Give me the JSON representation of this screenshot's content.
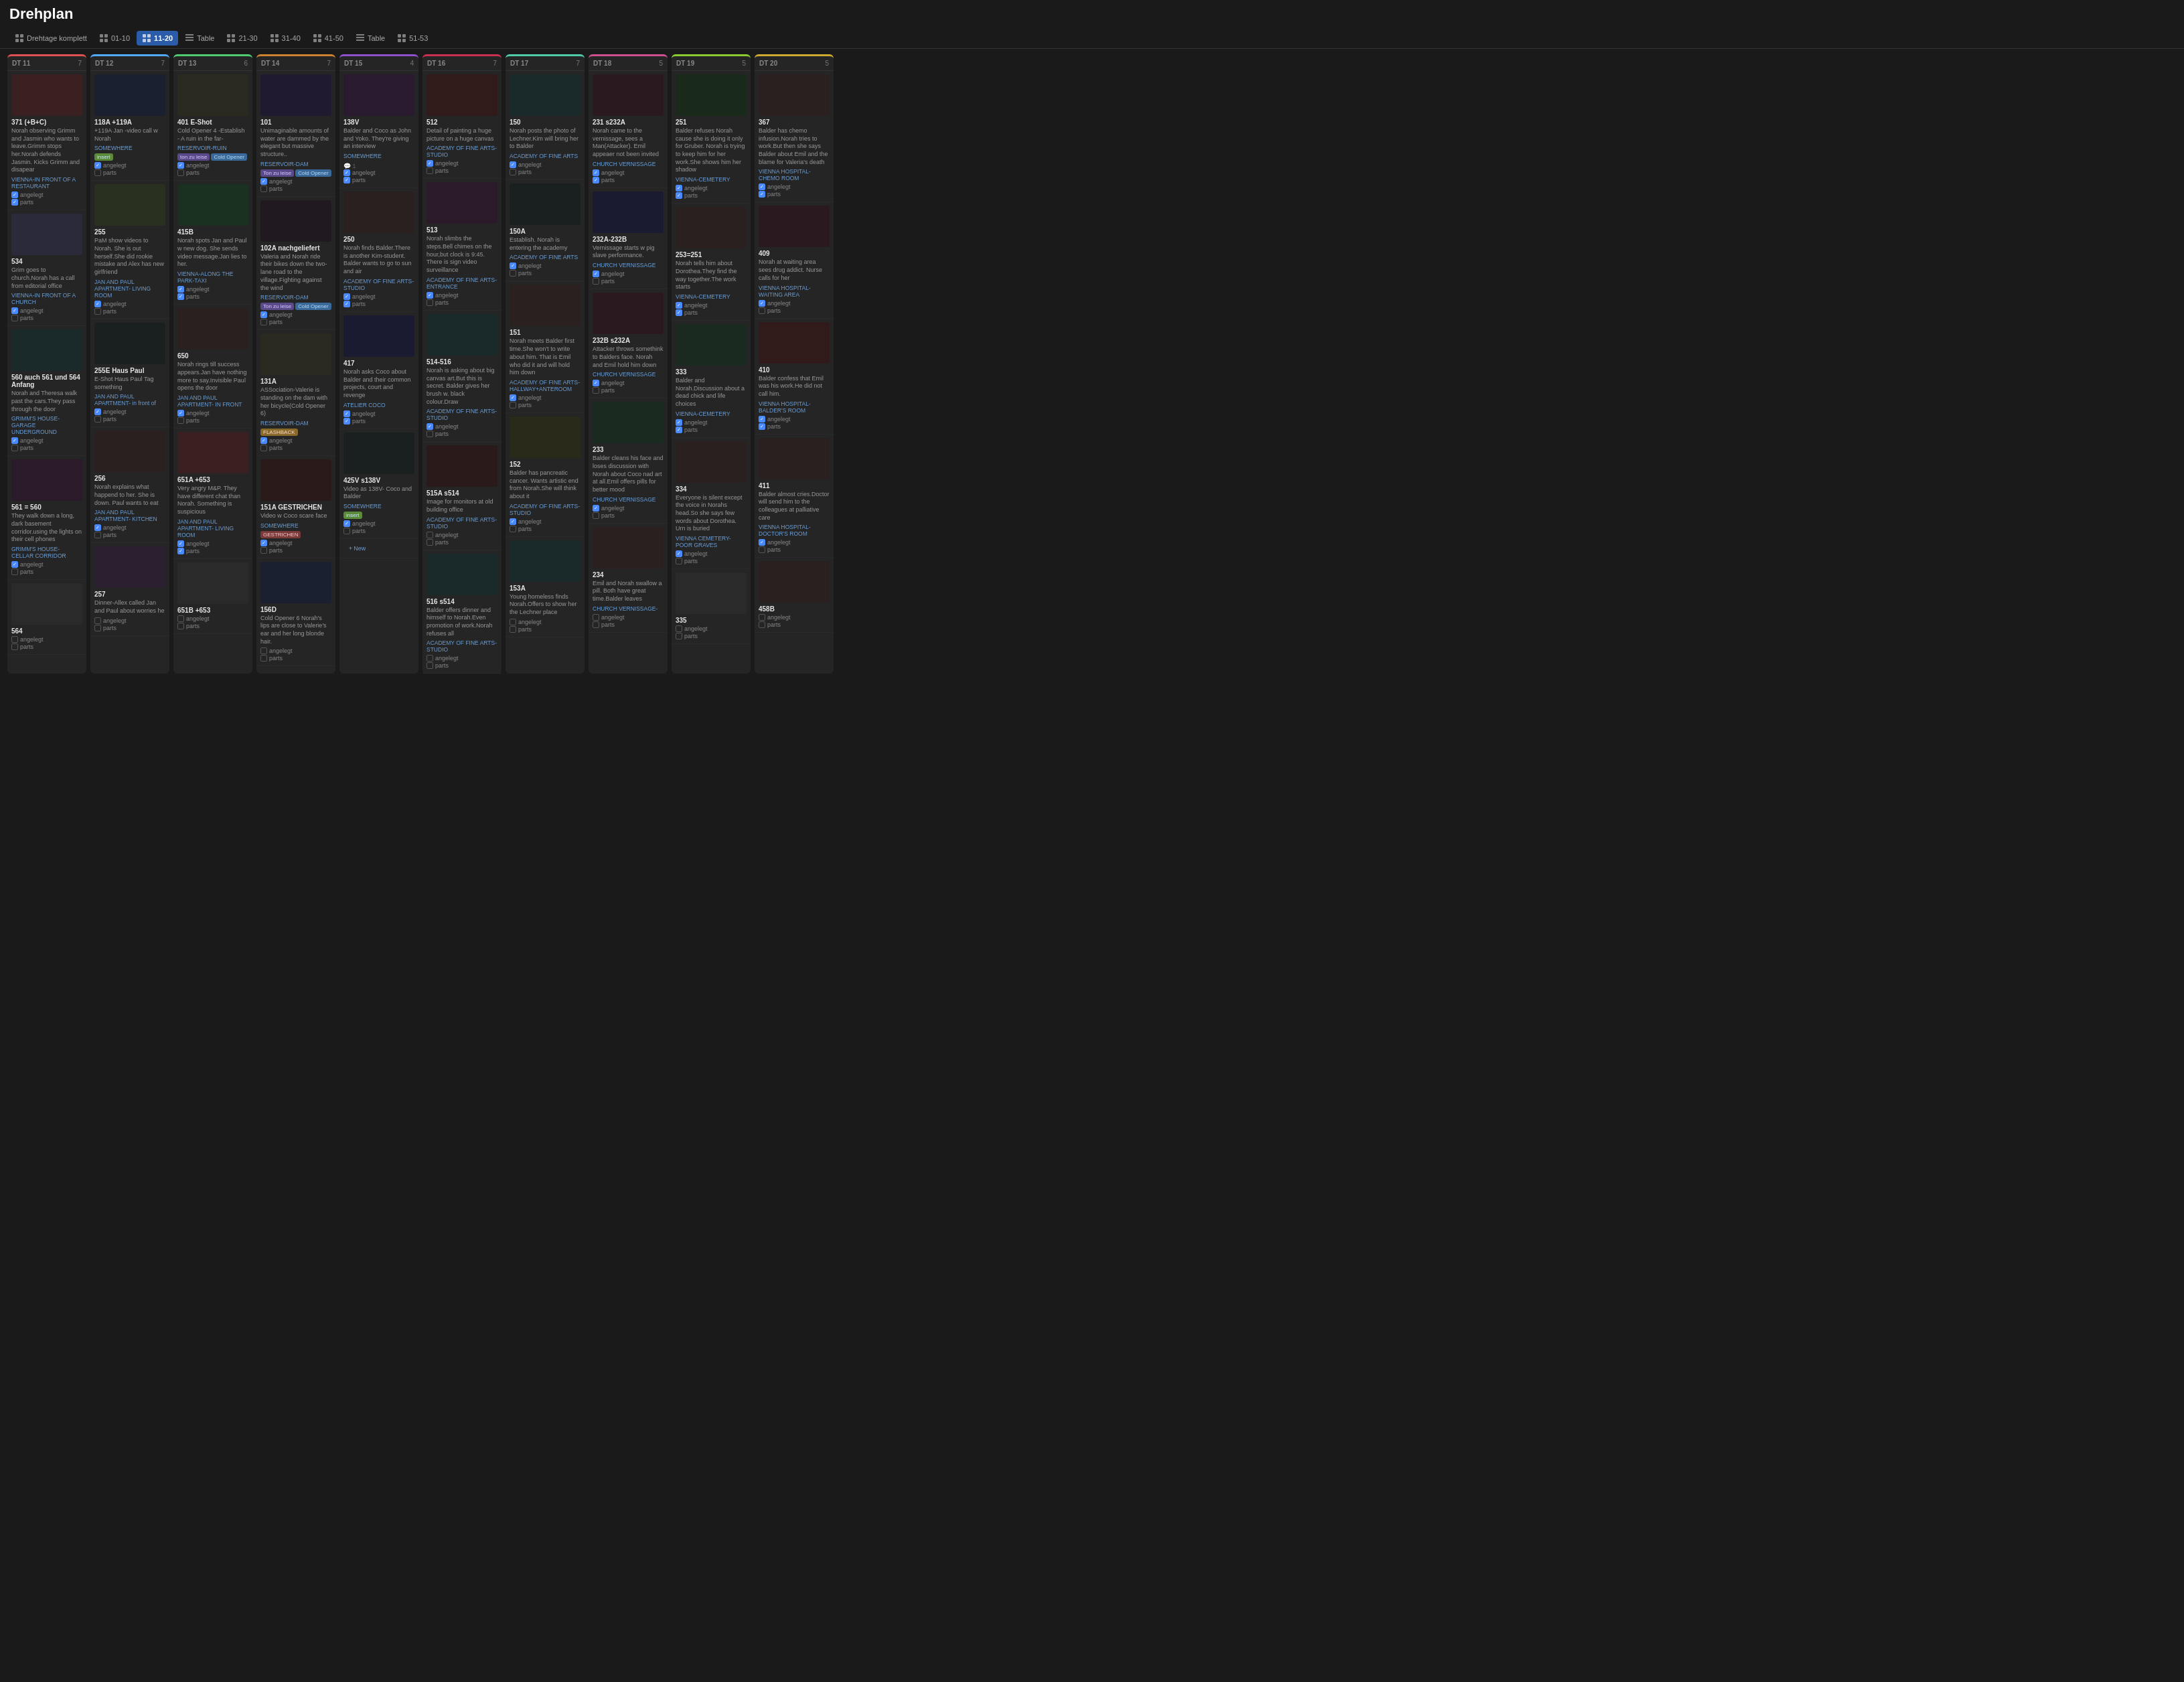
{
  "app": {
    "title": "Drehplan"
  },
  "nav": {
    "items": [
      {
        "id": "drehtage",
        "label": "Drehtage komplett",
        "icon": "grid",
        "active": false
      },
      {
        "id": "01-10",
        "label": "01-10",
        "icon": "grid",
        "active": false
      },
      {
        "id": "11-20",
        "label": "11-20",
        "icon": "grid",
        "active": true
      },
      {
        "id": "table1",
        "label": "Table",
        "icon": "table",
        "active": false
      },
      {
        "id": "21-30",
        "label": "21-30",
        "icon": "grid",
        "active": false
      },
      {
        "id": "31-40",
        "label": "31-40",
        "icon": "grid",
        "active": false
      },
      {
        "id": "41-50",
        "label": "41-50",
        "icon": "grid",
        "active": false
      },
      {
        "id": "table2",
        "label": "Table",
        "icon": "table",
        "active": false
      },
      {
        "id": "51-53",
        "label": "51-53",
        "icon": "grid",
        "active": false
      }
    ]
  },
  "columns": [
    {
      "id": "dt11",
      "dt": "DT 11",
      "count": 7,
      "colorClass": "dt11",
      "scenes": [
        {
          "title": "371 (+B+C)",
          "desc": "Norah observing Grimm and Jasmin who wants to leave.Grimm stops her.Norah defends Jasmin. Kicks Grimm and disapear",
          "location": "VIENNA-IN FRONT OF A RESTAURANT",
          "angelegt": true,
          "parts": true,
          "hasComment": false,
          "tags": []
        },
        {
          "title": "534",
          "desc": "Grim goes to church.Norah has a call from editorial office",
          "location": "VIENNA-IN FRONT OF A CHURCH",
          "angelegt": true,
          "parts": false,
          "hasComment": false,
          "tags": []
        },
        {
          "title": "560 auch 561 und 564 Anfang",
          "desc": "Norah and Theresa walk past the cars.They pass through the door",
          "location": "GRIMM'S HOUSE- GARAGE UNDERGROUND",
          "angelegt": true,
          "parts": false,
          "hasComment": false,
          "tags": []
        },
        {
          "title": "561 = 560",
          "desc": "They walk down a long, dark basement corridor.using the lights on their cell phones",
          "location": "GRIMM'S HOUSE- CELLAR CORRIDOR",
          "angelegt": true,
          "parts": false,
          "hasComment": false,
          "tags": []
        },
        {
          "title": "564",
          "desc": "",
          "location": "",
          "angelegt": false,
          "parts": false,
          "hasComment": false,
          "tags": []
        }
      ]
    },
    {
      "id": "dt12",
      "dt": "DT 12",
      "count": 7,
      "colorClass": "dt12",
      "scenes": [
        {
          "title": "118A +119A",
          "desc": "+119A Jan -video call w Norah",
          "location": "SOMEWHERE",
          "angelegt": true,
          "parts": false,
          "hasComment": false,
          "tags": [
            "insert"
          ]
        },
        {
          "title": "255",
          "desc": "PaM show videos to Norah. She is out herself.She did rookie mistake and Alex has new girlfriend",
          "location": "JAN AND PAUL APARTMENT- LIVING ROOM",
          "angelegt": true,
          "parts": false,
          "hasComment": false,
          "tags": []
        },
        {
          "title": "255E Haus Paul",
          "desc": "E-Shot Haus Paul Tag something",
          "location": "JAN AND PAUL APARTMENT- in front of",
          "angelegt": true,
          "parts": false,
          "hasComment": false,
          "tags": []
        },
        {
          "title": "256",
          "desc": "Norah explains what happend to her. She is down. Paul wants to eat",
          "location": "JAN AND PAUL APARTMENT- KITCHEN",
          "angelegt": true,
          "parts": false,
          "hasComment": false,
          "tags": []
        },
        {
          "title": "257",
          "desc": "Dinner-Allex called Jan and Paul about worries he",
          "location": "",
          "angelegt": false,
          "parts": false,
          "hasComment": false,
          "tags": []
        }
      ]
    },
    {
      "id": "dt13",
      "dt": "DT 13",
      "count": 6,
      "colorClass": "dt13",
      "scenes": [
        {
          "title": "401 E-Shot",
          "desc": "Cold Opener 4 -Establish - A ruin in the far-",
          "location": "RESERVOIR-RUIN",
          "angelegt": true,
          "parts": false,
          "hasComment": false,
          "tags": [
            "ton zu leise",
            "Cold Opener"
          ]
        },
        {
          "title": "415B",
          "desc": "Norah spots Jan and Paul w new dog. She sends video message.Jan lies to her.",
          "location": "VIENNA-ALONG THE PARK-TAXI",
          "angelegt": true,
          "parts": true,
          "hasComment": false,
          "tags": []
        },
        {
          "title": "650",
          "desc": "Norah rings till success appears.Jan have nothing more to say.Invisible Paul opens the door",
          "location": "JAN AND PAUL APARTMENT- IN FRONT",
          "angelegt": true,
          "parts": false,
          "hasComment": false,
          "tags": []
        },
        {
          "title": "651A +653",
          "desc": "Very angry M&P. They have different chat than Norah. Something is suspicious",
          "location": "JAN AND PAUL APARTMENT- LIVING ROOM",
          "angelegt": true,
          "parts": true,
          "hasComment": false,
          "tags": []
        },
        {
          "title": "651B +653",
          "desc": "",
          "location": "",
          "angelegt": false,
          "parts": false,
          "hasComment": false,
          "tags": []
        }
      ]
    },
    {
      "id": "dt14",
      "dt": "DT 14",
      "count": 7,
      "colorClass": "dt14",
      "scenes": [
        {
          "title": "101",
          "desc": "Unimaginable amounts of water are dammed by the elegant but massive structure..",
          "location": "RESERVOIR-DAM",
          "angelegt": true,
          "parts": false,
          "hasComment": false,
          "tags": [
            "Ton zu leise",
            "Cold Opener"
          ]
        },
        {
          "title": "102A nachgeliefert",
          "desc": "Valeria and Norah ride their bikes down the two-lane road to the village.Fighting against the wind",
          "location": "RESERVOIR-DAM",
          "angelegt": true,
          "parts": false,
          "hasComment": false,
          "tags": [
            "Ton zu leise",
            "Cold Opener"
          ]
        },
        {
          "title": "131A",
          "desc": "ASSociation-Valerie is standing on the dam with her bicycle(Cold Opener 6)",
          "location": "RESERVOIR-DAM",
          "angelegt": true,
          "parts": false,
          "hasComment": false,
          "tags": [
            "FLASHBACK"
          ]
        },
        {
          "title": "151A GESTRICHEN",
          "desc": "Video w Coco scare face",
          "location": "SOMEWHERE",
          "angelegt": true,
          "parts": false,
          "hasComment": false,
          "tags": [
            "GESTRICHEN"
          ]
        },
        {
          "title": "156D",
          "desc": "Cold Opener 6 Norah's lips are close to Valerie's ear and her long blonde hair.",
          "location": "",
          "angelegt": false,
          "parts": false,
          "hasComment": false,
          "tags": []
        }
      ]
    },
    {
      "id": "dt15",
      "dt": "DT 15",
      "count": 4,
      "colorClass": "dt15",
      "scenes": [
        {
          "title": "138V",
          "desc": "Balder and Coco as John and Yoko. They're giving an interview",
          "location": "SOMEWHERE",
          "angelegt": true,
          "parts": true,
          "hasComment": true,
          "tags": []
        },
        {
          "title": "250",
          "desc": "Norah finds Balder.There is another Kim-student. Balder wants to go to sun and air",
          "location": "ACADEMY OF FINE ARTS- STUDIO",
          "angelegt": true,
          "parts": true,
          "hasComment": false,
          "tags": []
        },
        {
          "title": "417",
          "desc": "Norah asks Coco about Balder and their common projects, court and revenge",
          "location": "ATELIER COCO",
          "angelegt": true,
          "parts": true,
          "hasComment": false,
          "tags": []
        },
        {
          "title": "425V s138V",
          "desc": "Video as 138V- Coco and Balder",
          "location": "SOMEWHERE",
          "angelegt": true,
          "parts": false,
          "hasComment": false,
          "tags": [
            "insert"
          ]
        },
        {
          "title": "New",
          "isNew": true,
          "desc": "",
          "location": "",
          "angelegt": false,
          "parts": false,
          "hasComment": false,
          "tags": []
        }
      ]
    },
    {
      "id": "dt16",
      "dt": "DT 16",
      "count": 7,
      "colorClass": "dt16",
      "scenes": [
        {
          "title": "512",
          "desc": "Detail of painting a huge picture on a huge canvas",
          "location": "ACADEMY OF FINE ARTS- STUDIO",
          "angelegt": true,
          "parts": false,
          "hasComment": false,
          "tags": []
        },
        {
          "title": "513",
          "desc": "Norah slimbs the steps.Bell chimes on the hour,but clock is 9:45. There is sign video surveillance",
          "location": "ACADEMY OF FINE ARTS- ENTRANCE",
          "angelegt": true,
          "parts": false,
          "hasComment": false,
          "tags": []
        },
        {
          "title": "514-516",
          "desc": "Norah is asking about big canvas art.But this is secret. Balder gives her brush w. black colour.Draw",
          "location": "ACADEMY OF FINE ARTS- STUDIO",
          "angelegt": true,
          "parts": false,
          "hasComment": false,
          "tags": []
        },
        {
          "title": "515A s514",
          "desc": "Image for monitors at old building office",
          "location": "ACADEMY OF FINE ARTS- STUDIO",
          "angelegt": false,
          "parts": false,
          "hasComment": false,
          "tags": []
        },
        {
          "title": "516 s514",
          "desc": "Balder offers dinner and himself to Norah.Even promotion of work.Norah refuses all",
          "location": "ACADEMY OF FINE ARTS- STUDIO",
          "angelegt": false,
          "parts": false,
          "hasComment": false,
          "tags": []
        }
      ]
    },
    {
      "id": "dt17",
      "dt": "DT 17",
      "count": 7,
      "colorClass": "dt17",
      "scenes": [
        {
          "title": "150",
          "desc": "Norah posts the photo of Lechner.Kim will bring her to Balder",
          "location": "ACADEMY OF FINE ARTS",
          "angelegt": true,
          "parts": false,
          "hasComment": false,
          "tags": []
        },
        {
          "title": "150A",
          "desc": "Establish. Norah is entering the academy",
          "location": "ACADEMY OF FINE ARTS",
          "angelegt": true,
          "parts": false,
          "hasComment": false,
          "tags": []
        },
        {
          "title": "151",
          "desc": "Norah meets Balder first time.She won't to write about him. That is Emil who did it and will hold him down",
          "location": "ACADEMY OF FINE ARTS- HALLWAY+ANTEROOM",
          "angelegt": true,
          "parts": false,
          "hasComment": false,
          "tags": []
        },
        {
          "title": "152",
          "desc": "Balder has pancreatic cancer. Wants artistic end from Norah.She will think about it",
          "location": "ACADEMY OF FINE ARTS- STUDIO",
          "angelegt": true,
          "parts": false,
          "hasComment": false,
          "tags": []
        },
        {
          "title": "153A",
          "desc": "Young homeless finds Norah.Offers to show her the Lechner place",
          "location": "",
          "angelegt": false,
          "parts": false,
          "hasComment": false,
          "tags": []
        }
      ]
    },
    {
      "id": "dt18",
      "dt": "DT 18",
      "count": 5,
      "colorClass": "dt18",
      "scenes": [
        {
          "title": "231 s232A",
          "desc": "Norah came to the vernissage, sees a Man(Attacker). Emil appeaer not been invited",
          "location": "CHURCH VERNISSAGE",
          "angelegt": true,
          "parts": true,
          "hasComment": false,
          "tags": []
        },
        {
          "title": "232A-232B",
          "desc": "Vernissage starts w pig slave performance.",
          "location": "CHURCH VERNISSAGE",
          "angelegt": true,
          "parts": false,
          "hasComment": false,
          "tags": []
        },
        {
          "title": "232B s232A",
          "desc": "Attacker throws somethink to Balders face. Norah and Emil hold him down",
          "location": "CHURCH VERNISSAGE",
          "angelegt": true,
          "parts": false,
          "hasComment": false,
          "tags": []
        },
        {
          "title": "233",
          "desc": "Balder cleans his face and loses discussion with Norah about Coco nad art at all.Emil offers pills for better mood",
          "location": "CHURCH VERNISSAGE",
          "angelegt": true,
          "parts": false,
          "hasComment": false,
          "tags": []
        },
        {
          "title": "234",
          "desc": "Emil and Norah swallow a pill. Both have great time.Balder leaves",
          "location": "CHURCH VERNISSAGE-",
          "angelegt": false,
          "parts": false,
          "hasComment": false,
          "tags": []
        }
      ]
    },
    {
      "id": "dt19",
      "dt": "DT 19",
      "count": 5,
      "colorClass": "dt19",
      "scenes": [
        {
          "title": "251",
          "desc": "Balder refuses Norah cause she is doing it only for Gruber. Norah is trying to keep him for her work.She shows him her shadow",
          "location": "VIENNA-CEMETERY",
          "angelegt": true,
          "parts": true,
          "hasComment": false,
          "tags": []
        },
        {
          "title": "253=251",
          "desc": "Norah tells him about Dorothea.They find the way together.The work starts",
          "location": "VIENNA-CEMETERY",
          "angelegt": true,
          "parts": true,
          "hasComment": false,
          "tags": []
        },
        {
          "title": "333",
          "desc": "Balder and Norah.Discussion about a dead chick and life choices",
          "location": "VIENNA-CEMETERY",
          "angelegt": true,
          "parts": true,
          "hasComment": false,
          "tags": []
        },
        {
          "title": "334",
          "desc": "Everyone is silent except the voice in Norahs head.So she says few words about Dorothea. Urn is buried",
          "location": "VIENNA CEMETERY-POOR GRAVES",
          "angelegt": true,
          "parts": false,
          "hasComment": false,
          "tags": []
        },
        {
          "title": "335",
          "desc": "",
          "location": "",
          "angelegt": false,
          "parts": false,
          "hasComment": false,
          "tags": []
        }
      ]
    },
    {
      "id": "dt20",
      "dt": "DT 20",
      "count": 5,
      "colorClass": "dt20",
      "scenes": [
        {
          "title": "367",
          "desc": "Balder has chemo infusion.Norah tries to work.But then she says Balder about Emil and the blame for Valeria's death",
          "location": "VIENNA HOSPITAL-CHEMO ROOM",
          "angelegt": true,
          "parts": true,
          "hasComment": false,
          "tags": []
        },
        {
          "title": "409",
          "desc": "Norah at waiting area sees drug addict. Nurse calls for her",
          "location": "VIENNA HOSPITAL- WAITING AREA",
          "angelegt": true,
          "parts": false,
          "hasComment": false,
          "tags": []
        },
        {
          "title": "410",
          "desc": "Balder confess that Emil was his work.He did not call him.",
          "location": "VIENNA HOSPITAL- BALDER'S ROOM",
          "angelegt": true,
          "parts": true,
          "hasComment": false,
          "tags": []
        },
        {
          "title": "411",
          "desc": "Balder almost cries.Doctor will send him to the colleagues at palliative care",
          "location": "VIENNA HOSPITAL- DOCTOR'S ROOM",
          "angelegt": true,
          "parts": false,
          "hasComment": false,
          "tags": []
        },
        {
          "title": "458B",
          "desc": "",
          "location": "",
          "angelegt": false,
          "parts": false,
          "hasComment": false,
          "tags": []
        }
      ]
    }
  ],
  "labels": {
    "angelegt": "angelegt",
    "parts": "parts",
    "new_button": "+ New"
  }
}
